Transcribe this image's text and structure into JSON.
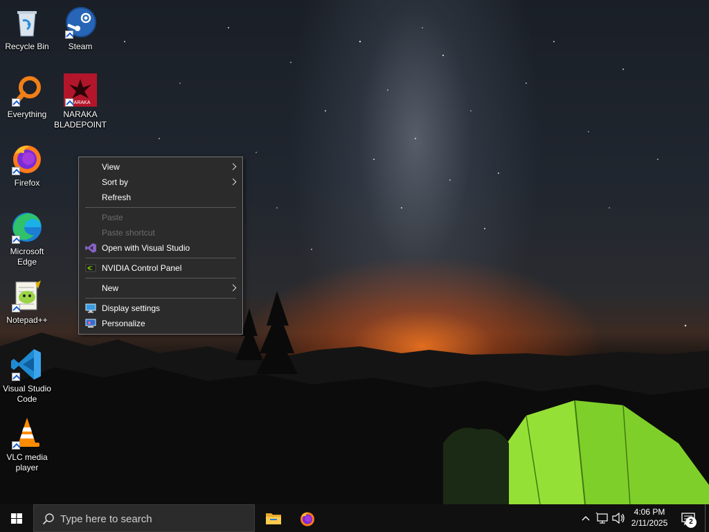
{
  "desktop": {
    "icons": [
      {
        "label": "Recycle Bin",
        "icon": "recycle-bin-icon"
      },
      {
        "label": "Steam",
        "icon": "steam-icon"
      },
      {
        "label": "Everything",
        "icon": "everything-search-icon"
      },
      {
        "label": "NARAKA\nBLADEPOINT",
        "icon": "naraka-bladepoint-icon",
        "icon_text": "NARAKA"
      },
      {
        "label": "Firefox",
        "icon": "firefox-icon"
      },
      {
        "label": "Microsoft\nEdge",
        "icon": "edge-icon"
      },
      {
        "label": "Notepad++",
        "icon": "notepad-plus-plus-icon"
      },
      {
        "label": "Visual Studio\nCode",
        "icon": "vscode-icon"
      },
      {
        "label": "VLC media\nplayer",
        "icon": "vlc-icon"
      }
    ]
  },
  "context_menu": {
    "items": [
      {
        "label": "View",
        "submenu": true,
        "enabled": true
      },
      {
        "label": "Sort by",
        "submenu": true,
        "enabled": true
      },
      {
        "label": "Refresh",
        "enabled": true
      },
      {
        "label": "Paste",
        "enabled": false
      },
      {
        "label": "Paste shortcut",
        "enabled": false
      },
      {
        "label": "Open with Visual Studio",
        "enabled": true,
        "icon": "visual-studio-icon"
      },
      {
        "label": "NVIDIA Control Panel",
        "enabled": true,
        "icon": "nvidia-icon"
      },
      {
        "label": "New",
        "submenu": true,
        "enabled": true
      },
      {
        "label": "Display settings",
        "enabled": true,
        "icon": "display-icon"
      },
      {
        "label": "Personalize",
        "enabled": true,
        "icon": "personalize-icon"
      }
    ]
  },
  "taskbar": {
    "search_placeholder": "Type here to search",
    "pinned": [
      {
        "name": "File Explorer",
        "icon": "folder-icon"
      },
      {
        "name": "Firefox",
        "icon": "firefox-icon"
      }
    ],
    "clock": {
      "time": "4:06 PM",
      "date": "2/11/2025"
    },
    "notification_count": "2"
  },
  "colors": {
    "menu_bg": "#2b2b2b",
    "taskbar_bg": "#101010",
    "accent_vs": "#8661c5",
    "nvidia_green": "#76b900"
  }
}
